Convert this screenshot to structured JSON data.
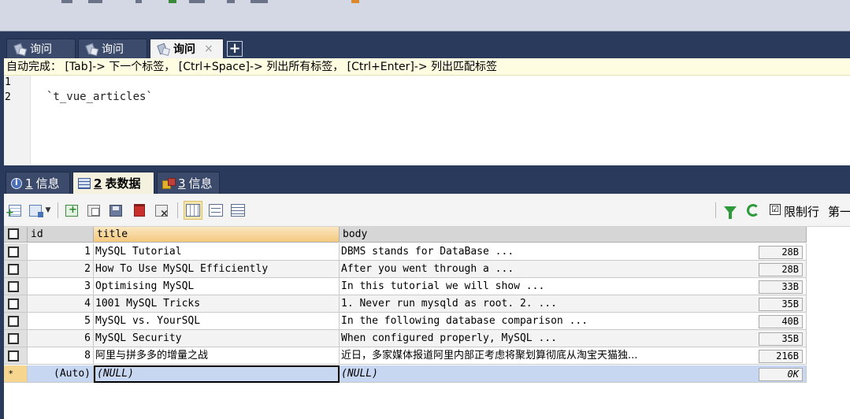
{
  "query_tabs": [
    {
      "label": "询问",
      "active": false
    },
    {
      "label": "询问",
      "active": false
    },
    {
      "label": "询问",
      "active": true,
      "close": "×"
    }
  ],
  "add_tab_label": "+",
  "editor": {
    "autocomplete_hint": "自动完成： [Tab]-> 下一个标签， [Ctrl+Space]-> 列出所有标签， [Ctrl+Enter]-> 列出匹配标签",
    "lines": [
      {
        "number": "1",
        "text": ""
      },
      {
        "number": "2",
        "text": "`t_vue_articles`"
      }
    ]
  },
  "result_tabs": [
    {
      "num": "1",
      "label": "信息",
      "icon": "info-icon",
      "active": false
    },
    {
      "num": "2",
      "label": "表数据",
      "icon": "table-grid-icon",
      "active": true
    },
    {
      "num": "3",
      "label": "信息",
      "icon": "messages-icon",
      "active": false
    }
  ],
  "grid_toolbar": {
    "limit_rows_checked": "☑",
    "limit_rows_label": "限制行",
    "page_label": "第一"
  },
  "grid": {
    "columns": [
      {
        "name": "id"
      },
      {
        "name": "title"
      },
      {
        "name": "body"
      }
    ],
    "rows": [
      {
        "id": "1",
        "title": "MySQL Tutorial",
        "body": "DBMS stands for DataBase ...",
        "size": "28B"
      },
      {
        "id": "2",
        "title": "How To Use MySQL Efficiently",
        "body": "After you went through a ...",
        "size": "28B"
      },
      {
        "id": "3",
        "title": "Optimising MySQL",
        "body": "In this tutorial we will show ...",
        "size": "33B"
      },
      {
        "id": "4",
        "title": "1001 MySQL Tricks",
        "body": "1. Never run mysqld as root. 2. ...",
        "size": "35B"
      },
      {
        "id": "5",
        "title": "MySQL vs. YourSQL",
        "body": "In the following database comparison ...",
        "size": "40B"
      },
      {
        "id": "6",
        "title": "MySQL Security",
        "body": "When configured properly, MySQL ...",
        "size": "35B"
      },
      {
        "id": "8",
        "title": "阿里与拼多多的增量之战",
        "body": "近日，多家媒体报道阿里内部正考虑将聚划算彻底从淘宝天猫独...",
        "size": "216B"
      }
    ],
    "new_row": {
      "marker": "*",
      "id": "(Auto)",
      "title": "(NULL)",
      "body": "(NULL)",
      "size": "0K"
    }
  }
}
